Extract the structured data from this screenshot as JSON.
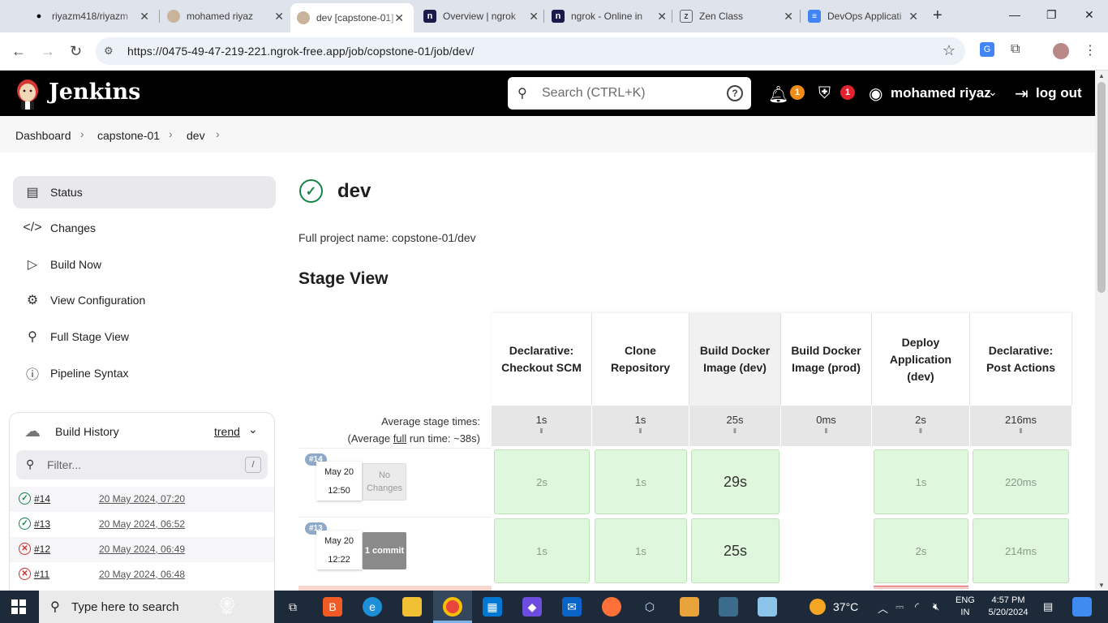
{
  "browser": {
    "tabs": [
      {
        "title": "riyazm418/riyazm",
        "icon": "github-icon"
      },
      {
        "title": "mohamed riyaz",
        "icon": "jenkins-icon"
      },
      {
        "title": "dev [capstone-01]",
        "icon": "jenkins-icon",
        "active": true
      },
      {
        "title": "Overview | ngrok",
        "icon": "ngrok-icon"
      },
      {
        "title": "ngrok - Online in",
        "icon": "ngrok-icon"
      },
      {
        "title": "Zen Class",
        "icon": "zen-class-icon"
      },
      {
        "title": "DevOps Applicati",
        "icon": "google-docs-icon"
      }
    ],
    "url": "https://0475-49-47-219-221.ngrok-free.app/job/copstone-01/job/dev/"
  },
  "header": {
    "brand": "Jenkins",
    "search_placeholder": "Search (CTRL+K)",
    "notifications_count": "1",
    "security_count": "1",
    "user": "mohamed riyaz",
    "logout": "log out"
  },
  "breadcrumb": [
    "Dashboard",
    "capstone-01",
    "dev"
  ],
  "sidebar": {
    "items": [
      {
        "label": "Status",
        "icon": "status-icon"
      },
      {
        "label": "Changes",
        "icon": "code-icon"
      },
      {
        "label": "Build Now",
        "icon": "play-icon"
      },
      {
        "label": "View Configuration",
        "icon": "gear-icon"
      },
      {
        "label": "Full Stage View",
        "icon": "search-icon"
      },
      {
        "label": "Pipeline Syntax",
        "icon": "help-icon"
      }
    ]
  },
  "build_history": {
    "title": "Build History",
    "trend": "trend",
    "filter_placeholder": "Filter...",
    "filter_shortcut": "/",
    "builds": [
      {
        "number": "#14",
        "date": "20 May 2024, 07:20",
        "status": "success"
      },
      {
        "number": "#13",
        "date": "20 May 2024, 06:52",
        "status": "success"
      },
      {
        "number": "#12",
        "date": "20 May 2024, 06:49",
        "status": "failure"
      },
      {
        "number": "#11",
        "date": "20 May 2024, 06:48",
        "status": "failure"
      }
    ]
  },
  "main": {
    "title": "dev",
    "full_project_name": "Full project name: copstone-01/dev",
    "stage_view_title": "Stage View",
    "avg_label_line1": "Average stage times:",
    "avg_label_line2_prefix": "(Average ",
    "avg_label_full": "full",
    "avg_label_line2_suffix": " run time: ~38s)"
  },
  "stage_view": {
    "stages": [
      {
        "name": "Declarative: Checkout SCM",
        "avg": "1s"
      },
      {
        "name": "Clone Repository",
        "avg": "1s"
      },
      {
        "name": "Build Docker Image (dev)",
        "avg": "25s"
      },
      {
        "name": "Build Docker Image (prod)",
        "avg": "0ms"
      },
      {
        "name": "Deploy Application (dev)",
        "avg": "2s"
      },
      {
        "name": "Declarative: Post Actions",
        "avg": "216ms"
      }
    ],
    "runs": [
      {
        "badge": "#14",
        "date": "May 20",
        "time": "12:50",
        "changes": "No Changes",
        "cells": [
          "2s",
          "1s",
          "29s",
          "",
          "1s",
          "220ms"
        ]
      },
      {
        "badge": "#13",
        "date": "May 20",
        "time": "12:22",
        "changes": "1 commit",
        "cells": [
          "1s",
          "1s",
          "25s",
          "",
          "2s",
          "214ms"
        ]
      }
    ]
  },
  "taskbar": {
    "search_placeholder": "Type here to search",
    "weather": "37°C",
    "lang_line1": "ENG",
    "lang_line2": "IN",
    "time": "4:57 PM",
    "date": "5/20/2024"
  }
}
